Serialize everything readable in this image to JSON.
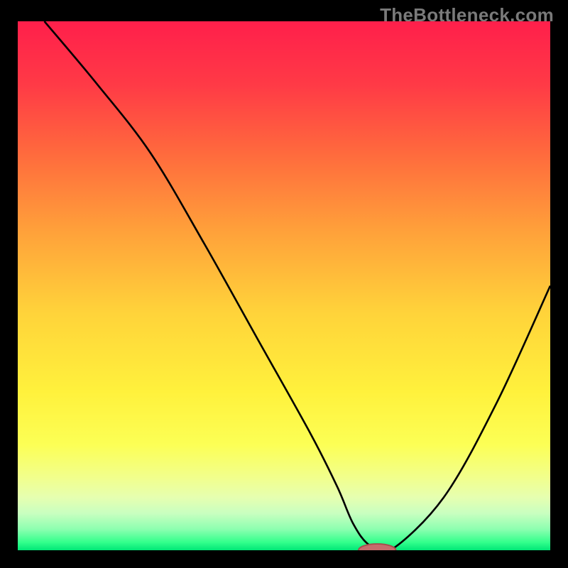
{
  "watermark": "TheBottleneck.com",
  "colors": {
    "black": "#000000",
    "curve": "#000000",
    "marker_fill": "#c76c6c",
    "marker_stroke": "#a64d4d"
  },
  "gradient_stops": [
    {
      "offset": 0.0,
      "color": "#ff1f4b"
    },
    {
      "offset": 0.12,
      "color": "#ff3a46"
    },
    {
      "offset": 0.25,
      "color": "#ff6a3d"
    },
    {
      "offset": 0.4,
      "color": "#ffa23a"
    },
    {
      "offset": 0.55,
      "color": "#ffd33a"
    },
    {
      "offset": 0.7,
      "color": "#fff13c"
    },
    {
      "offset": 0.8,
      "color": "#fcff55"
    },
    {
      "offset": 0.86,
      "color": "#f2ff8a"
    },
    {
      "offset": 0.9,
      "color": "#e6ffb0"
    },
    {
      "offset": 0.93,
      "color": "#c9ffc0"
    },
    {
      "offset": 0.96,
      "color": "#8dffb0"
    },
    {
      "offset": 0.985,
      "color": "#33ff8c"
    },
    {
      "offset": 1.0,
      "color": "#00e676"
    }
  ],
  "chart_data": {
    "type": "line",
    "title": "",
    "xlabel": "",
    "ylabel": "",
    "xlim": [
      0,
      100
    ],
    "ylim": [
      0,
      100
    ],
    "x": [
      5,
      15,
      25,
      35,
      45,
      55,
      60,
      63,
      66,
      70,
      80,
      90,
      100
    ],
    "values": [
      100,
      88,
      75,
      58,
      40,
      22,
      12,
      5,
      1,
      0,
      10,
      28,
      50
    ],
    "marker": {
      "x": 67.5,
      "y": 0,
      "rx": 3.5,
      "ry": 1.2
    },
    "annotations": []
  }
}
